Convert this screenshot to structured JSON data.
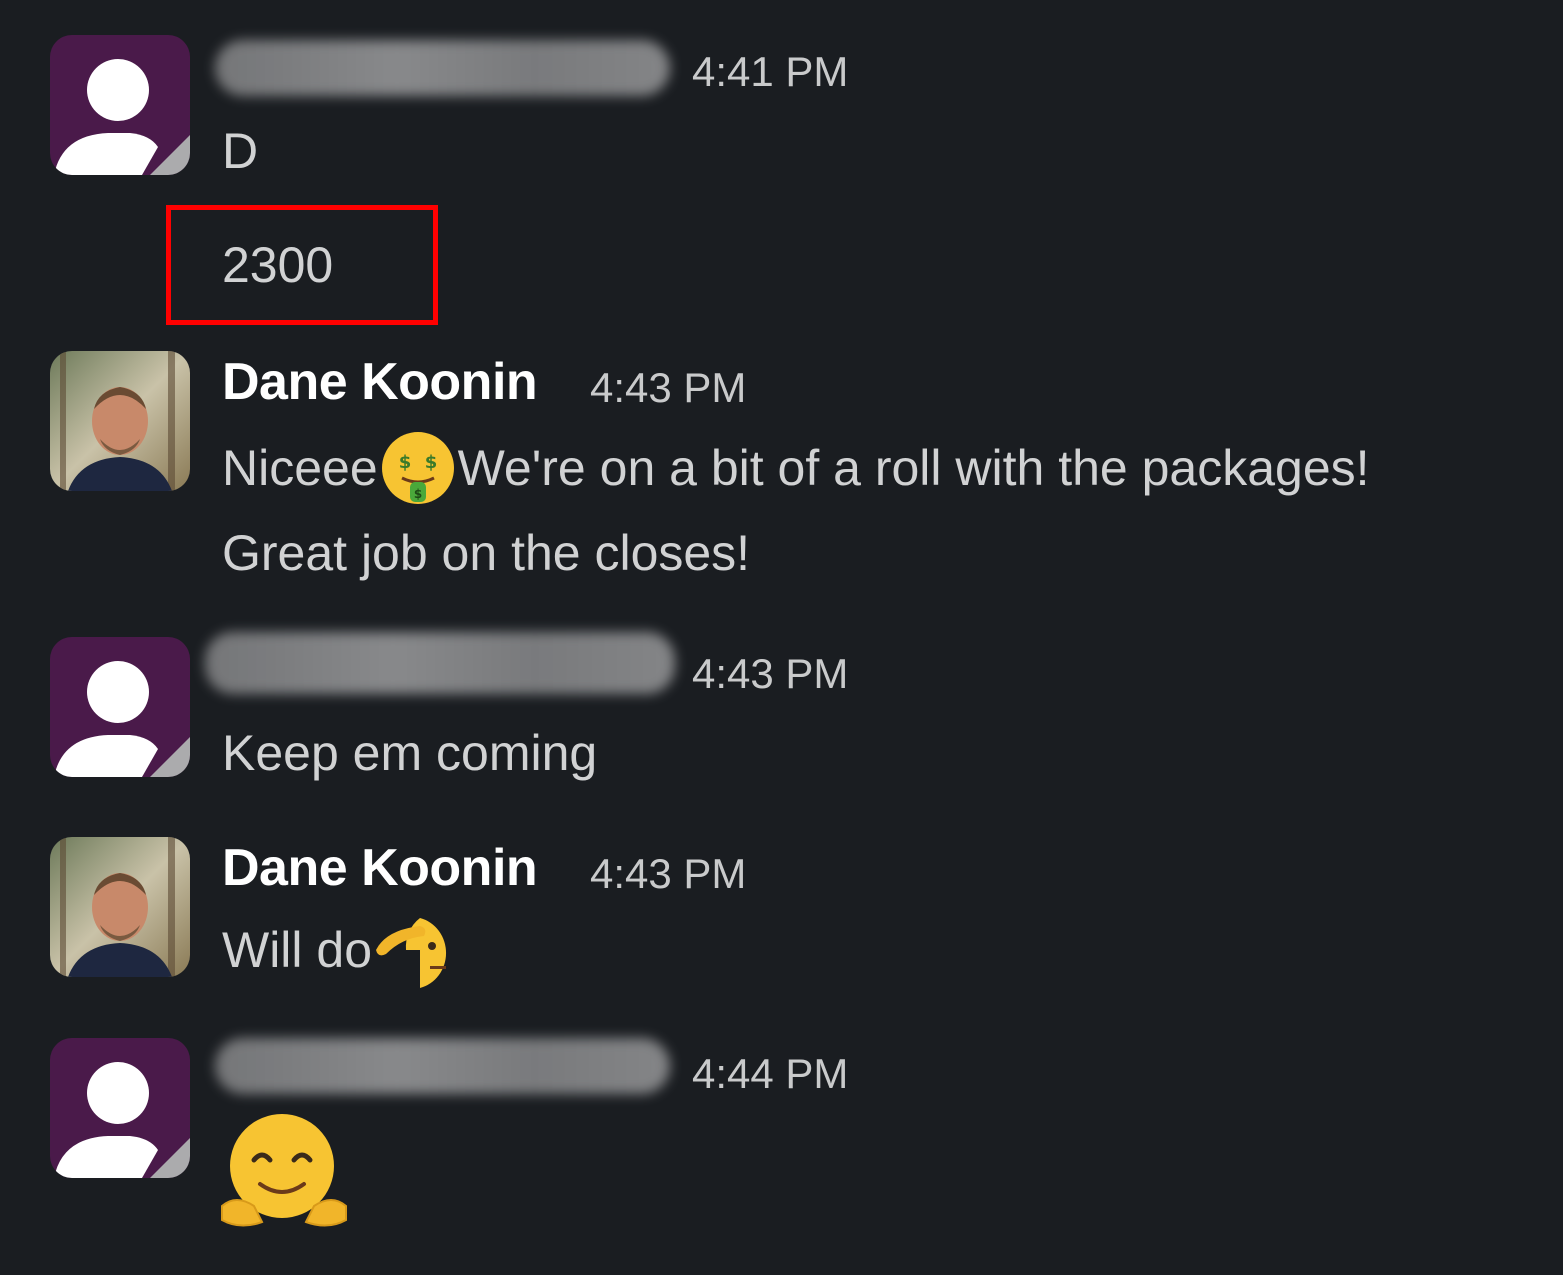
{
  "messages": [
    {
      "author": "",
      "author_redacted": true,
      "time": "4:41 PM",
      "lines": [
        "D",
        "2300"
      ]
    },
    {
      "author": "Dane Koonin",
      "author_redacted": false,
      "time": "4:43 PM",
      "line1_before": "Niceee",
      "line1_emoji": "money-mouth-face-emoji",
      "line1_after": "We're on a bit of a roll with the packages!",
      "line2": "Great job on the closes!"
    },
    {
      "author": "",
      "author_redacted": true,
      "time": "4:43 PM",
      "lines": [
        "Keep em coming"
      ]
    },
    {
      "author": "Dane Koonin",
      "author_redacted": false,
      "time": "4:43 PM",
      "text_before": "Will do",
      "emoji": "saluting-face-emoji"
    },
    {
      "author": "",
      "author_redacted": true,
      "time": "4:44 PM",
      "emoji": "hugging-face-emoji"
    }
  ],
  "colors": {
    "background": "#1a1d21",
    "default_avatar": "#4a1a4a",
    "highlight": "#ff0000",
    "name": "#ffffff",
    "text": "#d1d2d3"
  },
  "highlighted_value": "2300"
}
